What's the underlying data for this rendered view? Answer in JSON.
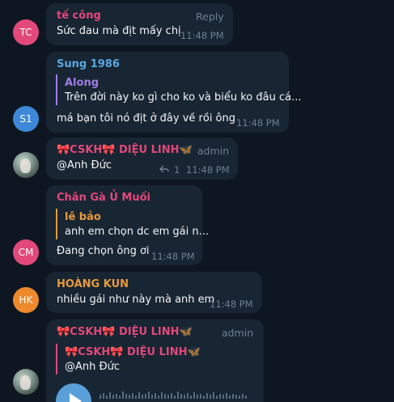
{
  "colors": {
    "background": "#0e1621",
    "bubble": "#182533",
    "meta_text": "#6d7f8f",
    "pink_name": "#e2487a",
    "blue_name": "#5aa7e0",
    "purple_name": "#a07ce6",
    "orange_name": "#e69a3c",
    "avatar_tc": "#e2487a",
    "avatar_s1": "#3d88d8",
    "avatar_cm": "#e2487a",
    "avatar_hk": "#ee8a2c"
  },
  "messages": [
    {
      "avatar": "TC",
      "sender": "tế công",
      "action": "Reply",
      "text": "Sức đau  mà địt mấy chị",
      "time": "11:48 PM"
    },
    {
      "avatar": "S1",
      "sender": "Sung 1986",
      "reply_to": {
        "sender": "Along",
        "text": "Trên đời này ko gì cho ko và biểu ko đâu cá..."
      },
      "text": "má bạn tôi nó địt ở đây về rồi ông a",
      "time": "11:48 PM"
    },
    {
      "avatar_icon": "profile-photo",
      "sender": "🎀CSKH🎀 DIỆU LINH🦋",
      "role": "admin",
      "text": "@Anh Đức",
      "reply_count": "1",
      "time": "11:48 PM"
    },
    {
      "avatar": "CM",
      "sender": "Chân Gà Ủ Muối",
      "reply_to": {
        "sender": "lê bảo",
        "text": "anh em chọn dc em gái n..."
      },
      "text": "Đang chọn ông ơi",
      "time": "11:48 PM"
    },
    {
      "avatar": "HK",
      "sender": "HOÀNG KUN",
      "text": "nhiều gái như này mà anh em",
      "time": "11:48 PM"
    },
    {
      "avatar_icon": "profile-photo",
      "sender": "🎀CSKH🎀 DIỆU LINH🦋",
      "role": "admin",
      "reply_to": {
        "sender": "🎀CSKH🎀 DIỆU LINH🦋",
        "text": "@Anh Đức"
      },
      "voice": "play-icon"
    }
  ]
}
